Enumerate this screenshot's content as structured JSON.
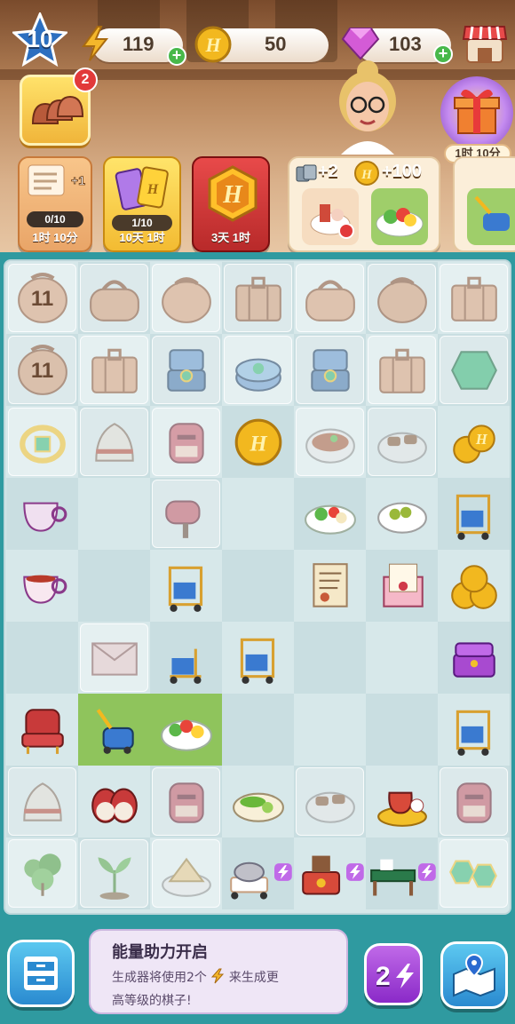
{
  "hud": {
    "level": "10",
    "energy": "119",
    "coins": "50",
    "gems": "103",
    "plus": "+"
  },
  "icons": {
    "level": "blue-star-icon",
    "energy": "lightning-bolt-icon",
    "coin": "gold-h-coin-icon",
    "gem": "pink-gem-icon",
    "shop": "shop-stall-icon",
    "tiles": "roof-tiles-icon",
    "gift": "gift-box-icon",
    "map": "map-location-icon",
    "inventory": "drawer-cabinet-icon"
  },
  "left_tile": {
    "badge": "2"
  },
  "gift_timer": "1时 10分",
  "event_cards": [
    {
      "progress": "0/10",
      "timer": "1时 10分",
      "reward": "+1"
    },
    {
      "progress": "1/10",
      "timer": "10天 1时"
    },
    {
      "timer": "3天 1时"
    }
  ],
  "order": {
    "reward_cards": "+2",
    "reward_coins": "+100"
  },
  "board": {
    "cols": 7,
    "rows": 9,
    "cells": [
      [
        "bag-round-11",
        "duffel-bag",
        "round-bag",
        "suitcase",
        "duffel-bag",
        "round-bag",
        "suitcase"
      ],
      [
        "bag-round-11",
        "suitcase",
        "ring-box-open",
        "ring-box-closed",
        "ring-box-open",
        "suitcase",
        "emerald"
      ],
      [
        "emerald-ring",
        "bathrobe",
        "postbox",
        "h-coin",
        "stew-bowl",
        "tapas-plate",
        "coin-stack"
      ],
      [
        "teacup",
        "",
        "mailbox",
        "",
        "salad-plate",
        "olive-bowl",
        "luggage-cart"
      ],
      [
        "tea-cup-full",
        "",
        "luggage-cart",
        "",
        "letter",
        "love-letter",
        "coin-pile"
      ],
      [
        "",
        "envelope",
        "luggage-cart-small",
        "luggage-cart",
        "",
        "",
        "jewelry-box"
      ],
      [
        "armchair",
        "vacuum",
        "salad-bowl",
        "",
        "",
        "",
        "luggage-cart"
      ],
      [
        "bathrobe",
        "slippers",
        "postbox",
        "cucumber-plate",
        "tapas-plate",
        "tea-set",
        "postbox"
      ],
      [
        "plant",
        "sprout",
        "sandwich",
        "room-service-cart",
        "room-service-desk",
        "writing-desk",
        "emerald-pair"
      ]
    ],
    "eleven_label": "11"
  },
  "tip": {
    "title": "能量助力开启",
    "line1_a": "生成器将使用2个",
    "line1_b": "来生成更",
    "line2": "高等级的棋子!"
  },
  "double_btn": "2",
  "colors": {
    "board_bg": "#d7e8ea",
    "frame": "#2f9aa0",
    "energy": "#f4b72b",
    "coin": "#f2b81f",
    "gem": "#d45bd6",
    "plus": "#48b84a",
    "badge_red": "#e23a3a"
  }
}
